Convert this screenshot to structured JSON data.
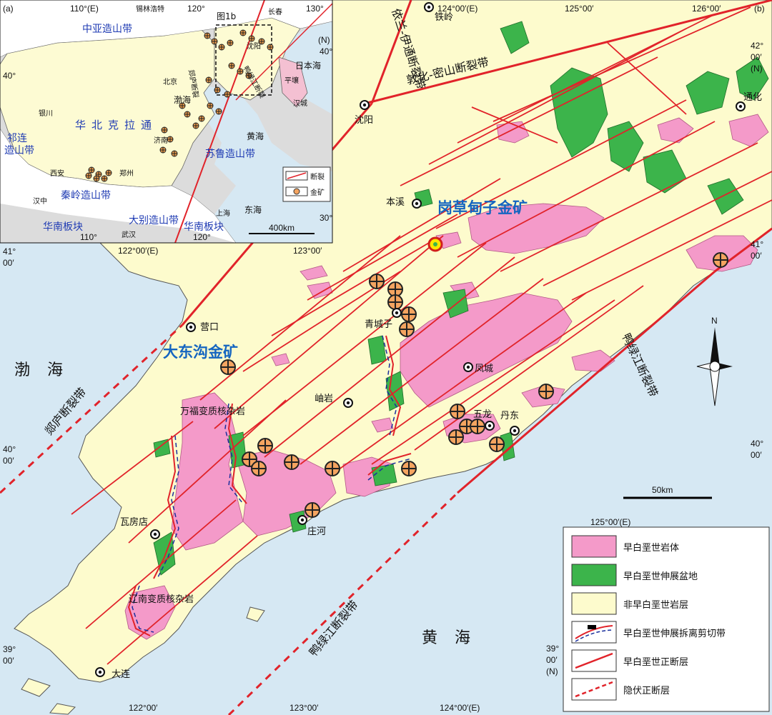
{
  "colors": {
    "sea": "#d6e8f3",
    "nonEK": "#fdfbcd",
    "granite": "#f49ac9",
    "basin": "#3cb44b",
    "fault": "#e1232a",
    "shear_dash": "#1a2f9c",
    "inset_land_yellow": "#fdfbd3",
    "inset_gray": "#dcdcdc",
    "inset_blue_text": "#1f3bb3",
    "highlight_text": "#1565c0"
  },
  "inset": {
    "panel_tag": "(a)",
    "box_label": "图1b",
    "top_ticks": [
      "110°(E)",
      "120°",
      "130°"
    ],
    "bottom_ticks": [
      "110°",
      "120°"
    ],
    "left_ticks": [
      "40°"
    ],
    "right_ticks": [
      "(N)",
      "40°",
      "30°"
    ],
    "regions": [
      "中亚造山带",
      "华北克拉通",
      "秦岭造山带",
      "大别造山带",
      "苏鲁造山带",
      "华南板块",
      "华南板块",
      "祁连",
      "造山带"
    ],
    "seas": [
      "渤海",
      "黄海",
      "东海",
      "日本海"
    ],
    "cities": [
      "锡林浩特",
      "长春",
      "沈阳",
      "北京",
      "平壤",
      "汉城",
      "银川",
      "济南",
      "西安",
      "郑州",
      "汉中",
      "上海",
      "武汉"
    ],
    "fault_labels": [
      "郯庐断裂",
      "鸭绿江断裂"
    ],
    "legend": {
      "fault": "断裂",
      "gold": "金矿"
    },
    "scale": "400km"
  },
  "main": {
    "panel_tag": "(b)",
    "top_ticks": [
      "124°00′(E)",
      "125°00′",
      "126°00′"
    ],
    "mid_ticks": [
      "122°00′(E)",
      "123°00′"
    ],
    "right_ticks": [
      "42°",
      "00′",
      "(N)",
      "41°",
      "00′",
      "40°",
      "00′",
      "125°00′(E)"
    ],
    "left_ticks": [
      "41°",
      "00′",
      "40°",
      "00′",
      "39°",
      "00′"
    ],
    "bottom_ticks": [
      "122°00′",
      "123°00′",
      "124°00′(E)"
    ],
    "right_bottom_ticks": [
      "39°",
      "00′",
      "(N)"
    ],
    "cities": [
      "铁岭",
      "沈阳",
      "通化",
      "本溪",
      "营口",
      "青城子",
      "凤城",
      "岫岩",
      "五龙",
      "丹东",
      "瓦房店",
      "庄河",
      "大连"
    ],
    "fault_belts": [
      "依兰-伊通断裂带",
      "敦化-密山断裂带",
      "郯庐断裂带",
      "鸭绿江断裂带",
      "鸭绿江断裂带"
    ],
    "complexes": [
      "万福变质核杂岩",
      "辽南变质核杂岩"
    ],
    "seas": [
      "渤海",
      "黄海"
    ],
    "highlights": [
      "岗草甸子金矿",
      "大东沟金矿"
    ],
    "scale": "50km",
    "north": "N"
  },
  "legend": [
    {
      "key": "granite",
      "label": "早白垩世岩体"
    },
    {
      "key": "basin",
      "label": "早白垩世伸展盆地"
    },
    {
      "key": "nonEK",
      "label": "非早白垩世岩层"
    },
    {
      "key": "shear",
      "label": "早白垩世伸展拆离剪切带"
    },
    {
      "key": "normal",
      "label": "早白垩世正断层"
    },
    {
      "key": "hidden",
      "label": "隐伏正断层"
    }
  ]
}
